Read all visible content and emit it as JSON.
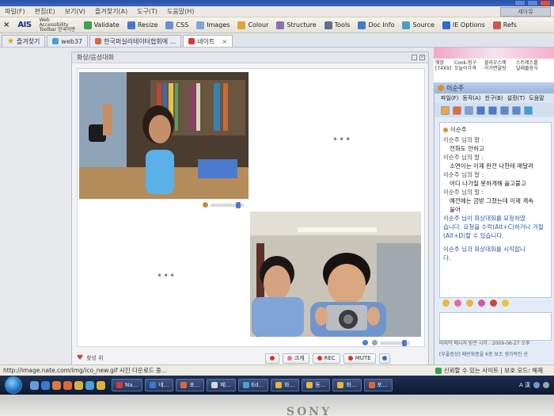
{
  "menubar": {
    "items": [
      "파일(F)",
      "편집(E)",
      "보기(V)",
      "즐겨찾기(A)",
      "도구(T)",
      "도움말(H)"
    ],
    "right_box": "세아뮤"
  },
  "toolbar": {
    "close_glyph": "×",
    "brand": "AIS",
    "brand_name": "Web Accessibility Toolbar 한국어판",
    "buttons": [
      "Validate",
      "Resize",
      "CSS",
      "Images",
      "Colour",
      "Structure",
      "Tools",
      "Doc Info",
      "Source",
      "IE Options",
      "Refs"
    ]
  },
  "tabs": {
    "favorites_label": "즐겨찾기",
    "items": [
      {
        "label": "web37",
        "active": false
      },
      {
        "label": "한국퍼실리테이터협회에 ...",
        "active": false
      },
      {
        "label": "네이트",
        "active": true
      }
    ]
  },
  "video_window": {
    "title": "화상/음성대화",
    "placeholder_dots": "•••",
    "buttons": {
      "favorite": "찾성 위",
      "record": "REC",
      "mute": "MUTE",
      "zoom": "크게"
    }
  },
  "sidebar_top": {
    "promos": [
      {
        "lines": [
          "해양",
          "[74X9]"
        ]
      },
      {
        "lines": [
          "Cook-팅구",
          "오늘이가격"
        ]
      },
      {
        "lines": [
          "블라우스에",
          "이거면을탓"
        ]
      },
      {
        "lines": [
          "스트레스를",
          "달래줄음식"
        ]
      }
    ]
  },
  "messenger": {
    "title": "이순주",
    "menu": [
      "파일(F)",
      "동작(A)",
      "친구(B)",
      "설정(T)",
      "도움말"
    ],
    "contact_tag": "이순주",
    "messages": [
      {
        "type": "head",
        "text": "이순주 님의 말 :"
      },
      {
        "type": "ind",
        "text": "전화도 안하고"
      },
      {
        "type": "head",
        "text": "이순주 님의 말 :"
      },
      {
        "type": "ind",
        "text": "소연이는 이제 완전 나한테 매달려"
      },
      {
        "type": "head",
        "text": "이순주 님의 말 :"
      },
      {
        "type": "ind",
        "text": "어디 나가질 못하게해 울고불고"
      },
      {
        "type": "head",
        "text": "이순주 님의 말 :"
      },
      {
        "type": "ind",
        "text": "예전에는 금방 그쳤는데 이제 계속"
      },
      {
        "type": "ind",
        "text": "울어"
      },
      {
        "type": "note",
        "text": "이순주 님이 화상대화를 요청하였"
      },
      {
        "type": "note2",
        "text": "습니다. 요청을 수락(Alt+C)하거나 거절"
      },
      {
        "type": "note2",
        "text": "(Alt+D)할 수 있습니다."
      },
      {
        "type": "note",
        "text": "이순주 님과 화상대화를 시작합니"
      },
      {
        "type": "note2",
        "text": "다."
      }
    ],
    "footer": "마지막 메시지 받은 시각 : 2009-06-27 오후",
    "footer2": "[우울증상] 패반화종을 6종 보조 생가적인 선"
  },
  "statusbar": {
    "url": "http://image.nate.com/img/ico_new.gif 사진 다운로드 중...",
    "zone": "신뢰할 수 있는 사이트 | 보호 모드: 해제"
  },
  "taskbar": {
    "tasks": [
      "Na...",
      "네...",
      "포...",
      "페...",
      "Ed...",
      "화...",
      "동...",
      "화...",
      "포..."
    ],
    "tray_text": "A 漢"
  },
  "bezel": {
    "brand": "SONY"
  },
  "colors": {
    "title_blue": "#2c4fa8",
    "record_red": "#d0392b",
    "accent": "#5077c4"
  }
}
